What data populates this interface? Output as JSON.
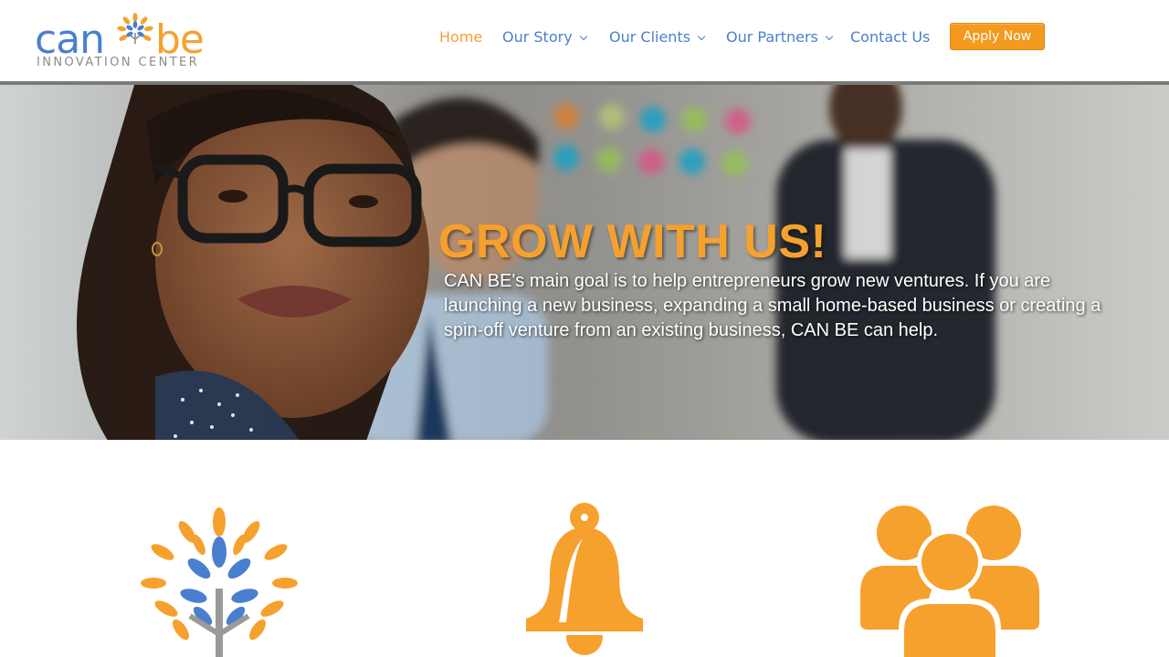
{
  "brand": {
    "logo_word_left": "can",
    "logo_word_right": "be",
    "logo_subtitle": "INNOVATION CENTER"
  },
  "nav": {
    "items": [
      {
        "label": "Home",
        "active": true,
        "has_dropdown": false
      },
      {
        "label": "Our Story",
        "active": false,
        "has_dropdown": true
      },
      {
        "label": "Our Clients",
        "active": false,
        "has_dropdown": true
      },
      {
        "label": "Our Partners",
        "active": false,
        "has_dropdown": true
      },
      {
        "label": "Contact Us",
        "active": false,
        "has_dropdown": false
      }
    ],
    "cta_label": "Apply Now"
  },
  "hero": {
    "title": "GROW WITH US!",
    "body": "CAN BE's main goal is to help entrepreneurs grow new ventures. If you are launching a new business, expanding a small home-based business or creating a spin-off venture from an existing business, CAN BE can help."
  },
  "features": [
    {
      "icon": "tree-icon"
    },
    {
      "icon": "bell-icon"
    },
    {
      "icon": "people-icon"
    }
  ],
  "colors": {
    "brand_blue": "#4a7fcf",
    "brand_orange": "#f6a12e",
    "button_orange": "#f39a1f"
  }
}
